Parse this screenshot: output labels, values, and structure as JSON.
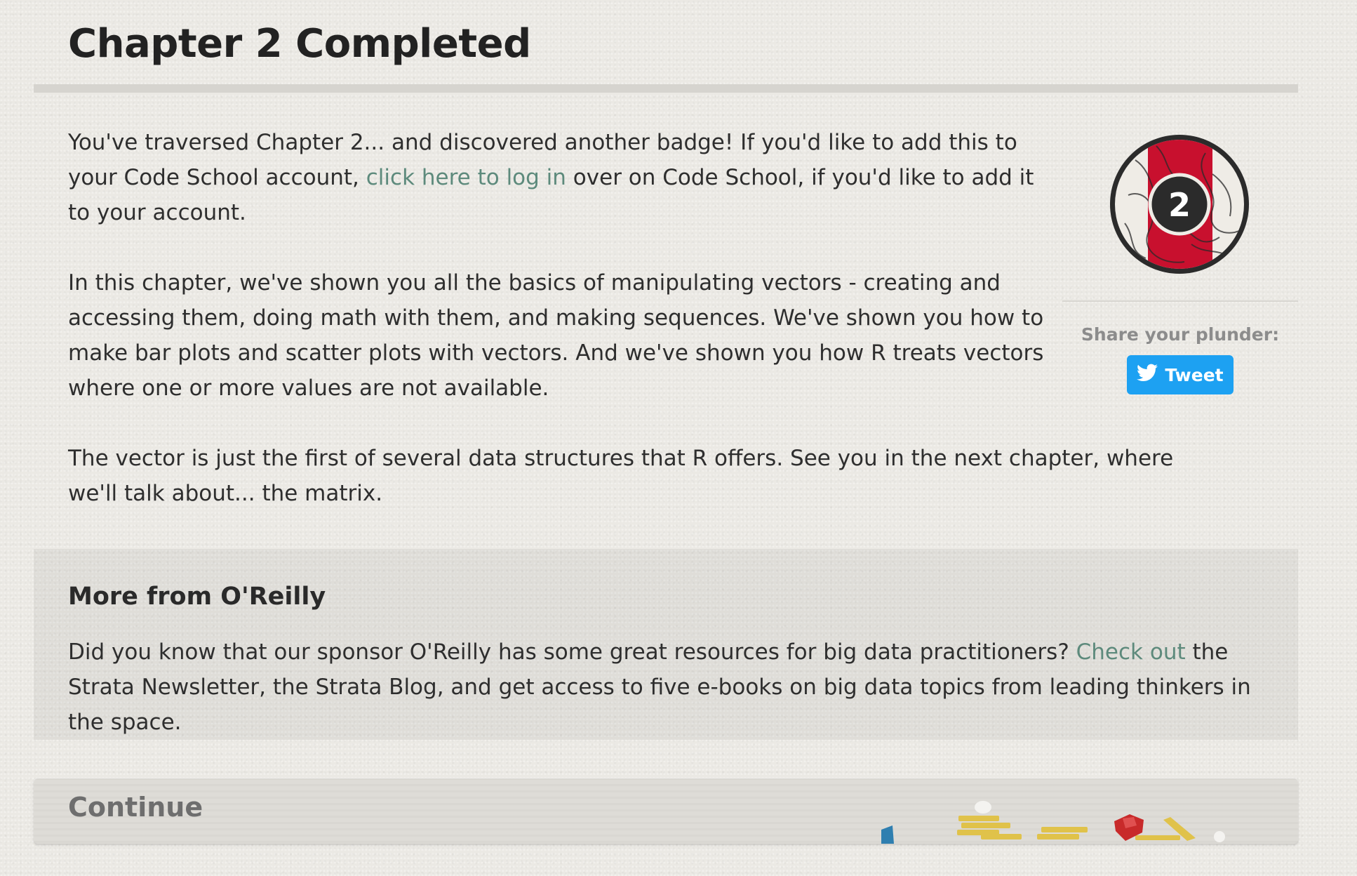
{
  "header": {
    "title": "Chapter 2 Completed"
  },
  "intro": {
    "p1_before": "You've traversed Chapter 2... and discovered another badge! If you'd like to add this to your Code School account, ",
    "p1_link": "click here to log in",
    "p1_after": " over on Code School, if you'd like to add it to your account.",
    "p2": "In this chapter, we've shown you all the basics of manipulating vectors - creating and accessing them, doing math with them, and making sequences. We've shown you how to make bar plots and scatter plots with vectors. And we've shown you how R treats vectors where one or more values are not available.",
    "p3": "The vector is just the first of several data structures that R offers. See you in the next chapter, where we'll talk about... the matrix."
  },
  "badge": {
    "number": "2",
    "icon": "chapter-badge-icon"
  },
  "share": {
    "label": "Share your plunder:",
    "tweet_label": "Tweet",
    "tweet_icon": "twitter-bird-icon",
    "tweet_color": "#1da1f2"
  },
  "sponsor": {
    "heading": "More from O'Reilly",
    "text_before": "Did you know that our sponsor O'Reilly has some great resources for big data practitioners? ",
    "link": "Check out",
    "text_after": " the Strata Newsletter, the Strata Blog, and get access to five e-books on big data topics from leading thinkers in the space."
  },
  "continue": {
    "label": "Continue",
    "decoration": "treasure-pile-icon"
  },
  "colors": {
    "link": "#5d8a7c",
    "badge_red": "#c8102e",
    "background": "#ebe9e4"
  }
}
